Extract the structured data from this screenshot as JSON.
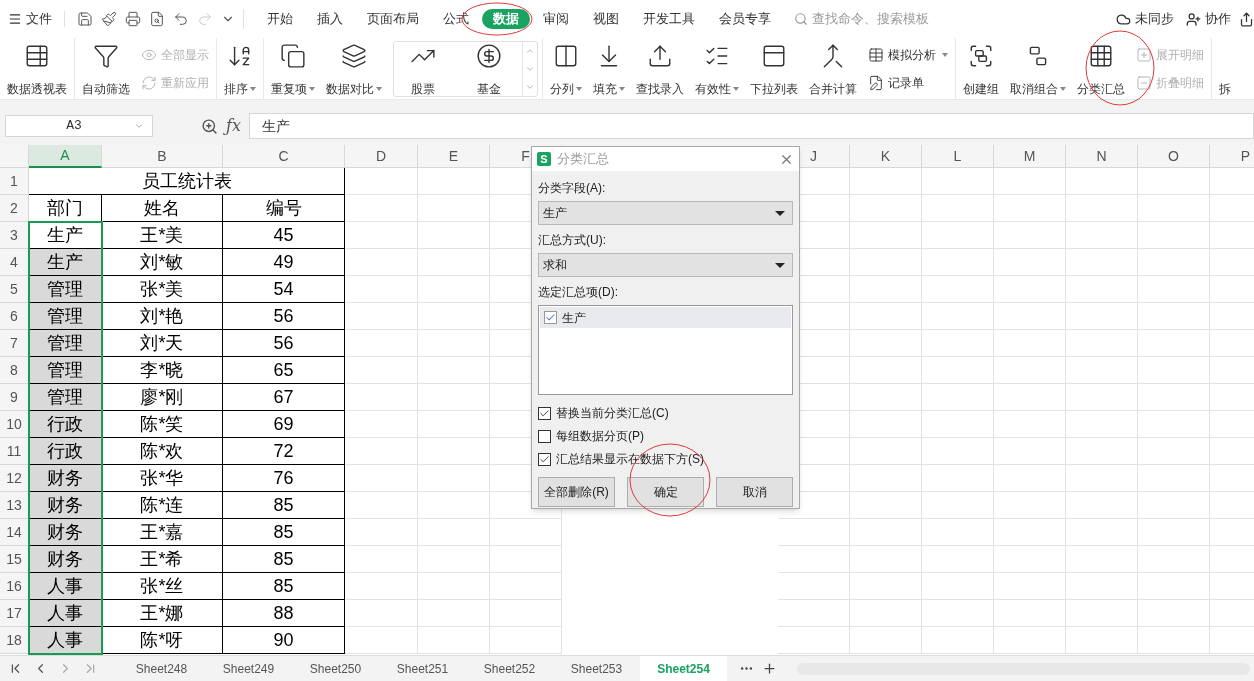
{
  "menu": {
    "file": "文件",
    "tabs": [
      {
        "label": "开始",
        "selected": false
      },
      {
        "label": "插入",
        "selected": false
      },
      {
        "label": "页面布局",
        "selected": false
      },
      {
        "label": "公式",
        "selected": false
      },
      {
        "label": "数据",
        "selected": true
      },
      {
        "label": "审阅",
        "selected": false
      },
      {
        "label": "视图",
        "selected": false
      },
      {
        "label": "开发工具",
        "selected": false
      },
      {
        "label": "会员专享",
        "selected": false
      }
    ],
    "search": {
      "placeholder": "查找命令、搜索模板"
    },
    "sync": "未同步",
    "collab": "协作"
  },
  "ribbon": [
    {
      "kind": "plain",
      "items": [
        {
          "label": "数据透视表",
          "kind": "large",
          "dropdown": false,
          "disabled": false
        }
      ]
    },
    {
      "kind": "plain",
      "items": [
        {
          "label": "自动筛选",
          "kind": "large",
          "dropdown": false,
          "disabled": false
        },
        {
          "label": "全部显示",
          "kind": "small",
          "dropdown": false,
          "disabled": true
        },
        {
          "label": "重新应用",
          "kind": "small",
          "dropdown": false,
          "disabled": true
        }
      ]
    },
    {
      "kind": "plain",
      "items": [
        {
          "label": "排序",
          "kind": "large",
          "dropdown": true,
          "disabled": false
        }
      ]
    },
    {
      "kind": "plain",
      "items": [
        {
          "label": "重复项",
          "kind": "large",
          "dropdown": true,
          "disabled": false
        },
        {
          "label": "数据对比",
          "kind": "large",
          "dropdown": true,
          "disabled": false
        }
      ]
    },
    {
      "kind": "gallery",
      "items": [
        {
          "label": "股票",
          "kind": "large",
          "dropdown": false,
          "disabled": false
        },
        {
          "label": "基金",
          "kind": "large",
          "dropdown": false,
          "disabled": false
        }
      ]
    },
    {
      "kind": "plain",
      "items": [
        {
          "label": "分列",
          "kind": "large",
          "dropdown": true,
          "disabled": false
        },
        {
          "label": "填充",
          "kind": "large",
          "dropdown": true,
          "disabled": false
        },
        {
          "label": "查找录入",
          "kind": "large",
          "dropdown": false,
          "disabled": false
        },
        {
          "label": "有效性",
          "kind": "large",
          "dropdown": true,
          "disabled": false
        },
        {
          "label": "下拉列表",
          "kind": "large",
          "dropdown": false,
          "disabled": false
        },
        {
          "label": "合并计算",
          "kind": "large",
          "dropdown": false,
          "disabled": false
        },
        {
          "label": "模拟分析",
          "kind": "small",
          "dropdown": true,
          "disabled": false
        },
        {
          "label": "记录单",
          "kind": "small",
          "dropdown": false,
          "disabled": false
        }
      ]
    },
    {
      "kind": "plain",
      "items": [
        {
          "label": "创建组",
          "kind": "large",
          "dropdown": false,
          "disabled": false
        },
        {
          "label": "取消组合",
          "kind": "large",
          "dropdown": true,
          "disabled": false
        },
        {
          "label": "分类汇总",
          "kind": "large",
          "dropdown": false,
          "disabled": false
        },
        {
          "label": "展开明细",
          "kind": "small",
          "dropdown": false,
          "disabled": true
        },
        {
          "label": "折叠明细",
          "kind": "small",
          "dropdown": false,
          "disabled": true
        }
      ]
    },
    {
      "kind": "plain",
      "items": [
        {
          "label": "拆",
          "kind": "large",
          "dropdown": false,
          "disabled": false
        }
      ]
    }
  ],
  "formula_bar": {
    "cell": "A3",
    "fx_label": "ƒx",
    "value": "生产"
  },
  "sheet": {
    "columns": [
      {
        "label": "A",
        "selected": true
      },
      {
        "label": "B",
        "selected": false
      },
      {
        "label": "C",
        "selected": false
      },
      {
        "label": "D",
        "selected": false
      },
      {
        "label": "E",
        "selected": false
      },
      {
        "label": "F",
        "selected": false
      },
      {
        "label": "J",
        "selected": false
      },
      {
        "label": "K",
        "selected": false
      },
      {
        "label": "L",
        "selected": false
      },
      {
        "label": "M",
        "selected": false
      },
      {
        "label": "N",
        "selected": false
      },
      {
        "label": "O",
        "selected": false
      },
      {
        "label": "P",
        "selected": false
      }
    ],
    "row_numbers": [
      "1",
      "2",
      "3",
      "4",
      "5",
      "6",
      "7",
      "8",
      "9",
      "10",
      "11",
      "12",
      "13",
      "14",
      "15",
      "16",
      "17",
      "18"
    ],
    "title": "员工统计表",
    "header": [
      "部门",
      "姓名",
      "编号"
    ],
    "rows": [
      [
        "生产",
        "王*美",
        "45"
      ],
      [
        "生产",
        "刘*敏",
        "49"
      ],
      [
        "管理",
        "张*美",
        "54"
      ],
      [
        "管理",
        "刘*艳",
        "56"
      ],
      [
        "管理",
        "刘*天",
        "56"
      ],
      [
        "管理",
        "李*晓",
        "65"
      ],
      [
        "管理",
        "廖*刚",
        "67"
      ],
      [
        "行政",
        "陈*笑",
        "69"
      ],
      [
        "行政",
        "陈*欢",
        "72"
      ],
      [
        "财务",
        "张*华",
        "76"
      ],
      [
        "财务",
        "陈*连",
        "85"
      ],
      [
        "财务",
        "王*嘉",
        "85"
      ],
      [
        "财务",
        "王*希",
        "85"
      ],
      [
        "人事",
        "张*丝",
        "85"
      ],
      [
        "人事",
        "王*娜",
        "88"
      ],
      [
        "人事",
        "陈*呀",
        "90"
      ]
    ]
  },
  "dialog": {
    "logo_letter": "S",
    "title": "分类汇总",
    "fields": [
      {
        "label": "分类字段(A):",
        "value": "生产"
      },
      {
        "label": "汇总方式(U):",
        "value": "求和"
      }
    ],
    "list": {
      "label": "选定汇总项(D):",
      "items": [
        {
          "label": "生产",
          "checked": true,
          "selected": true
        }
      ]
    },
    "options": [
      {
        "label": "替换当前分类汇总(C)",
        "checked": true
      },
      {
        "label": "每组数据分页(P)",
        "checked": false
      },
      {
        "label": "汇总结果显示在数据下方(S)",
        "checked": true
      }
    ],
    "buttons": [
      "全部删除(R)",
      "确定",
      "取消"
    ]
  },
  "sheet_tabs": [
    {
      "label": "Sheet248",
      "selected": false
    },
    {
      "label": "Sheet249",
      "selected": false
    },
    {
      "label": "Sheet250",
      "selected": false
    },
    {
      "label": "Sheet251",
      "selected": false
    },
    {
      "label": "Sheet252",
      "selected": false
    },
    {
      "label": "Sheet253",
      "selected": false
    },
    {
      "label": "Sheet254",
      "selected": true
    }
  ]
}
